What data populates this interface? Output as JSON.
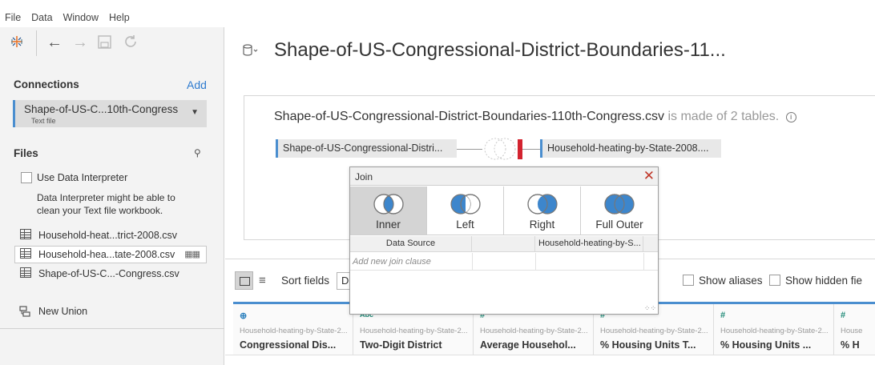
{
  "menu": [
    "File",
    "Data",
    "Window",
    "Help"
  ],
  "toolbar": {
    "logo_icon": "tableau-logo-icon",
    "back_icon": "arrow-left-icon",
    "forward_icon": "arrow-right-icon",
    "save_icon": "save-icon",
    "refresh_icon": "refresh-icon"
  },
  "connections": {
    "title": "Connections",
    "add_label": "Add",
    "items": [
      {
        "name": "Shape-of-US-C...10th-Congress",
        "type": "Text file"
      }
    ]
  },
  "files": {
    "title": "Files",
    "use_interpreter_label": "Use Data Interpreter",
    "interpreter_note": "Data Interpreter might be able to clean your Text file workbook.",
    "items": [
      {
        "label": "Household-heat...trict-2008.csv"
      },
      {
        "label": "Household-hea...tate-2008.csv"
      },
      {
        "label": "Shape-of-US-C...-Congress.csv"
      }
    ],
    "new_union_label": "New Union"
  },
  "datasource": {
    "title": "Shape-of-US-Congressional-District-Boundaries-11...",
    "full_name": "Shape-of-US-Congressional-District-Boundaries-110th-Congress.csv",
    "made_of_text": "is made of 2 tables.",
    "left_table": "Shape-of-US-Congressional-Distri...",
    "right_table": "Household-heating-by-State-2008...."
  },
  "join_dialog": {
    "title": "Join",
    "types": [
      "Inner",
      "Left",
      "Right",
      "Full Outer"
    ],
    "active_type": "Inner",
    "col_data_source": "Data Source",
    "col_right": "Household-heating-by-S...",
    "add_clause_placeholder": "Add new join clause"
  },
  "bottom_bar": {
    "sort_label": "Sort fields",
    "sort_value": "D",
    "show_aliases_label": "Show aliases",
    "show_hidden_label": "Show hidden fie"
  },
  "fields": [
    {
      "type_icon": "globe-icon",
      "type_glyph": "⊕",
      "source": "Household-heating-by-State-2...",
      "name": "Congressional Dis..."
    },
    {
      "type_icon": "abc-icon",
      "type_glyph": "Abc",
      "source": "Household-heating-by-State-2...",
      "name": "Two-Digit District"
    },
    {
      "type_icon": "number-icon",
      "type_glyph": "#",
      "source": "Household-heating-by-State-2...",
      "name": "Average Househol..."
    },
    {
      "type_icon": "number-icon",
      "type_glyph": "#",
      "source": "Household-heating-by-State-2...",
      "name": "% Housing Units T..."
    },
    {
      "type_icon": "number-icon",
      "type_glyph": "#",
      "source": "Household-heating-by-State-2...",
      "name": "% Housing Units ..."
    },
    {
      "type_icon": "number-icon",
      "type_glyph": "#",
      "source": "House",
      "name": "% H"
    }
  ],
  "colors": {
    "accent_blue": "#4a8ecf",
    "link_blue": "#2e7bcf",
    "warning_red": "#d3232f",
    "venn_fill": "#3d86cc"
  }
}
